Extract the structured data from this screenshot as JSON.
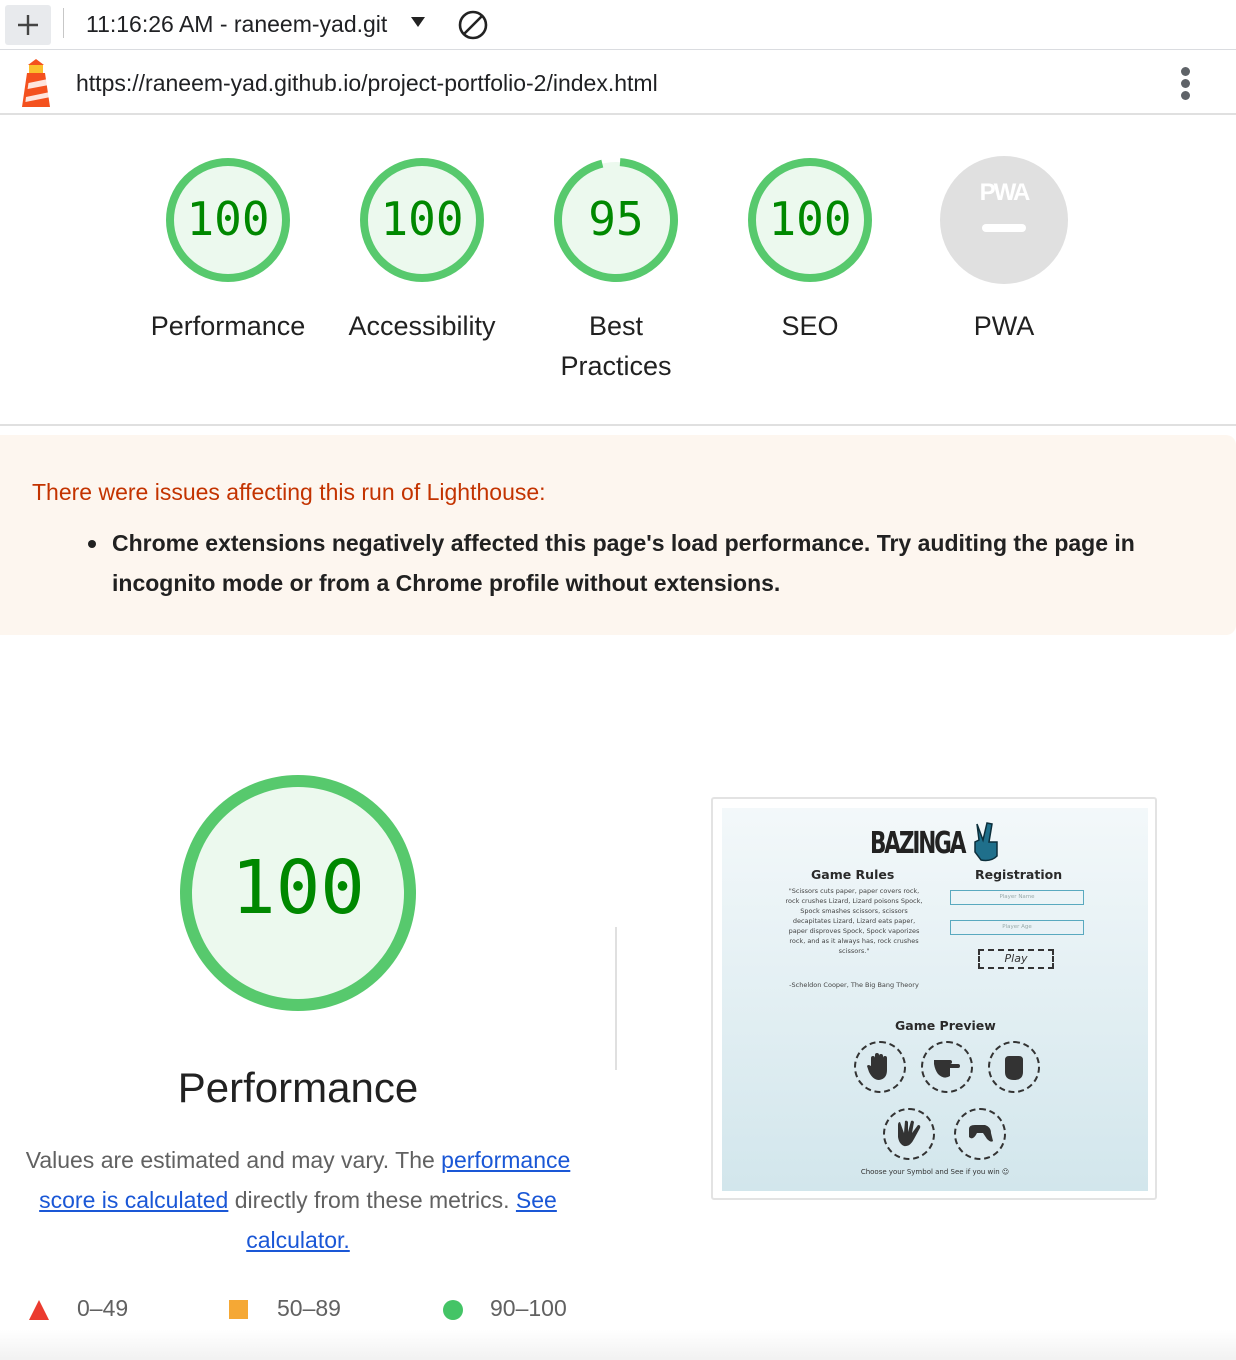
{
  "toolbar": {
    "run_selector": "11:16:26 AM - raneem-yad.git",
    "new_icon": "plus-icon",
    "clear_icon": "block-icon"
  },
  "address": {
    "url": "https://raneem-yad.github.io/project-portfolio-2/index.html",
    "logo_icon": "lighthouse-icon",
    "menu_icon": "kebab-menu-icon"
  },
  "scores": [
    {
      "label": "Performance",
      "value": "100",
      "fraction": 1.0
    },
    {
      "label": "Accessibility",
      "value": "100",
      "fraction": 1.0
    },
    {
      "label": "Best Practices",
      "value": "95",
      "fraction": 0.95
    },
    {
      "label": "SEO",
      "value": "100",
      "fraction": 1.0
    },
    {
      "label": "PWA",
      "value": "",
      "badge": "PWA"
    }
  ],
  "colors": {
    "pass": "#0cce6b",
    "pass_text": "#008800",
    "warning_text": "#c33300",
    "link": "#1a57d6"
  },
  "warning": {
    "title": "There were issues affecting this run of Lighthouse:",
    "items": [
      "Chrome extensions negatively affected this page's load performance. Try auditing the page in incognito mode or from a Chrome profile without extensions."
    ]
  },
  "performance": {
    "score": "100",
    "title": "Performance",
    "desc_prefix": "Values are estimated and may vary. The ",
    "desc_link": "performance score is calculated",
    "desc_middle": " directly from these metrics. ",
    "calc_link": "See calculator."
  },
  "legend": [
    {
      "range": "0–49",
      "shape": "triangle",
      "color": "#eb3b2f"
    },
    {
      "range": "50–89",
      "shape": "square",
      "color": "#f5a835"
    },
    {
      "range": "90–100",
      "shape": "circle",
      "color": "#44c466"
    }
  ],
  "screenshot": {
    "brand": "BAZINGA",
    "rules_heading": "Game Rules",
    "registration_heading": "Registration",
    "quote": "\"Scissors cuts paper, paper covers rock, rock crushes Lizard, Lizard poisons Spock, Spock smashes scissors, scissors decapitates Lizard, Lizard eats paper, paper disproves Spock, Spock vaporizes rock, and as it always has, rock crushes scissors.\"",
    "cite": "-Scheldon Cooper, The Big Bang Theory",
    "name_placeholder": "Player Name",
    "age_placeholder": "Player Age",
    "play_label": "Play",
    "preview_heading": "Game Preview",
    "footer": "Choose your Symbol and See if you win ☺"
  }
}
